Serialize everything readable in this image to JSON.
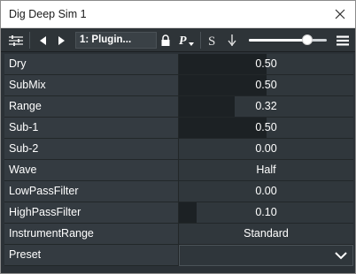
{
  "window": {
    "title": "Dig Deep Sim 1"
  },
  "toolbar": {
    "preset_name": "1: Plugin...",
    "icons": [
      "sliders-icon",
      "prev-arrow-icon",
      "next-arrow-icon",
      "lock-icon",
      "preset-menu-icon",
      "sidechain-s-icon",
      "bypass-pin-icon",
      "hamburger-menu-icon"
    ],
    "mix_slider": 0.75
  },
  "params": [
    {
      "name": "Dry",
      "value": "0.50",
      "level": 0.5
    },
    {
      "name": "SubMix",
      "value": "0.50",
      "level": 0.5
    },
    {
      "name": "Range",
      "value": "0.32",
      "level": 0.32
    },
    {
      "name": "Sub-1",
      "value": "0.50",
      "level": 0.5
    },
    {
      "name": "Sub-2",
      "value": "0.00",
      "level": 0.0
    },
    {
      "name": "Wave",
      "value": "Half",
      "level": 0
    },
    {
      "name": "LowPassFilter",
      "value": "0.00",
      "level": 0.0
    },
    {
      "name": "HighPassFilter",
      "value": "0.10",
      "level": 0.1
    },
    {
      "name": "InstrumentRange",
      "value": "Standard",
      "level": 0
    },
    {
      "name": "Preset",
      "value": "",
      "level": 0
    }
  ],
  "colors": {
    "panel": "#2b3136",
    "fill": "#1c2124",
    "text": "#ffffff"
  }
}
